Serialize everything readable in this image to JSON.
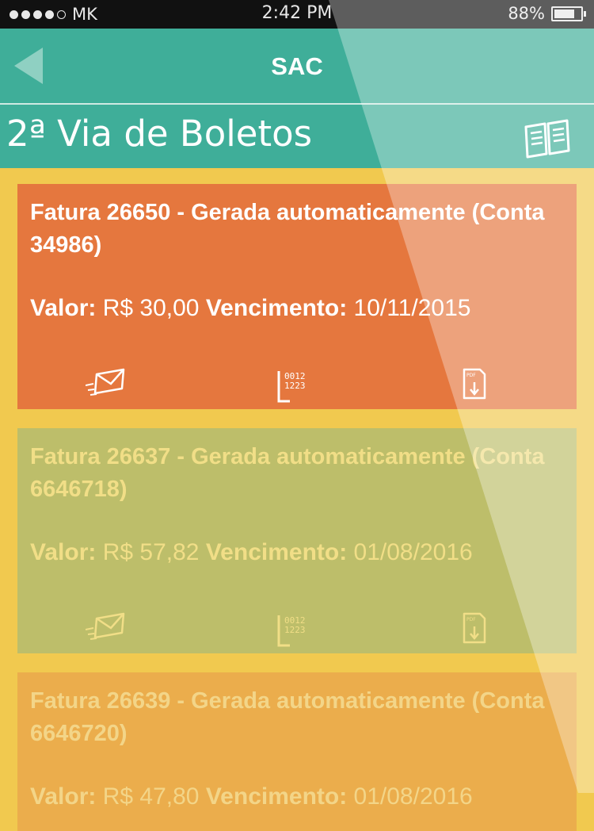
{
  "status_bar": {
    "carrier": "MK",
    "time": "2:42 PM",
    "battery": "88%",
    "battery_level": 0.88
  },
  "header": {
    "title": "SAC",
    "page_title": "2ª Via de Boletos"
  },
  "labels": {
    "value_label": "Valor:",
    "due_label": "Vencimento:"
  },
  "invoices": [
    {
      "title": "Fatura 26650 - Gerada automaticamente (Conta 34986)",
      "value": "R$ 30,00",
      "due": "10/11/2015"
    },
    {
      "title": "Fatura 26637 - Gerada automaticamente (Conta 6646718)",
      "value": "R$ 57,82",
      "due": "01/08/2016"
    },
    {
      "title": "Fatura 26639 - Gerada automaticamente (Conta 6646720)",
      "value": "R$ 47,80",
      "due": "01/08/2016"
    }
  ],
  "icons": {
    "back": "back-arrow-icon",
    "book": "book-icon",
    "email": "email-send-icon",
    "barcode": "barcode-icon",
    "pdf": "pdf-download-icon",
    "barcode_digits_top": "0012",
    "barcode_digits_bottom": "1223",
    "pdf_tag": "PDF"
  },
  "colors": {
    "header": "#3fae99",
    "background": "#f1c94f",
    "card_1": "#e5773e",
    "card_2": "#bdbe6a",
    "card_3": "#ebad4c"
  }
}
